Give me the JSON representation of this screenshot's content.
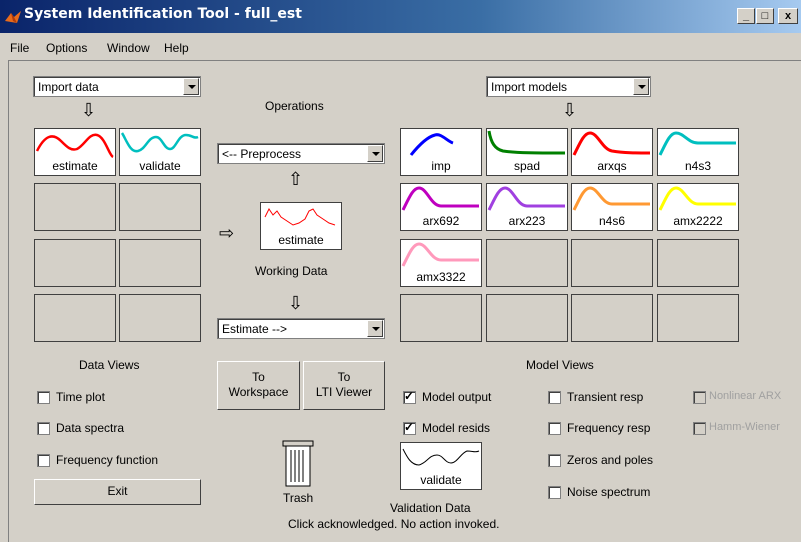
{
  "window": {
    "title": "System Identification Tool - full_est"
  },
  "title_buttons": {
    "minimize": "_",
    "maximize": "□",
    "close": "x"
  },
  "menu": [
    "File",
    "Options",
    "Window",
    "Help"
  ],
  "import_data": {
    "selected": "Import data"
  },
  "import_models": {
    "selected": "Import models"
  },
  "operations": {
    "label": "Operations"
  },
  "preprocess": {
    "selected": "<-- Preprocess"
  },
  "estimate": {
    "selected": "Estimate -->"
  },
  "working_data": {
    "tile_label": "estimate",
    "caption": "Working Data"
  },
  "data_tiles": [
    {
      "label": "estimate",
      "color": "#ff0000",
      "icon": "signal-plot"
    },
    {
      "label": "validate",
      "color": "#00bfbf",
      "icon": "signal-plot"
    }
  ],
  "data_views": {
    "label": "Data Views",
    "items": [
      {
        "label": "Time plot",
        "checked": false
      },
      {
        "label": "Data spectra",
        "checked": false
      },
      {
        "label": "Frequency function",
        "checked": false
      }
    ]
  },
  "exit_button": "Exit",
  "to_workspace": {
    "line1": "To",
    "line2": "Workspace"
  },
  "to_lti": {
    "line1": "To",
    "line2": "LTI Viewer"
  },
  "model_tiles": [
    {
      "label": "imp",
      "color": "#0000ff"
    },
    {
      "label": "spad",
      "color": "#008000"
    },
    {
      "label": "arxqs",
      "color": "#ff0000"
    },
    {
      "label": "n4s3",
      "color": "#00bfbf"
    },
    {
      "label": "arx692",
      "color": "#bf00bf"
    },
    {
      "label": "arx223",
      "color": "#a040e0"
    },
    {
      "label": "n4s6",
      "color": "#ff9933"
    },
    {
      "label": "amx2222",
      "color": "#ffff00"
    },
    {
      "label": "amx3322",
      "color": "#ff99bb"
    }
  ],
  "model_views": {
    "label": "Model Views",
    "col1": [
      {
        "label": "Model output",
        "checked": true
      },
      {
        "label": "Model resids",
        "checked": true
      }
    ],
    "col2": [
      {
        "label": "Transient resp",
        "checked": false
      },
      {
        "label": "Frequency resp",
        "checked": false
      },
      {
        "label": "Zeros and poles",
        "checked": false
      },
      {
        "label": "Noise spectrum",
        "checked": false
      }
    ],
    "col3": [
      {
        "label": "Nonlinear ARX",
        "checked": false,
        "disabled": true
      },
      {
        "label": "Hamm-Wiener",
        "checked": false,
        "disabled": true
      }
    ]
  },
  "trash": {
    "label": "Trash",
    "icon": "trash-can-icon"
  },
  "validation_data": {
    "tile_label": "validate",
    "caption": "Validation Data"
  },
  "status": "Click acknowledged. No action invoked."
}
